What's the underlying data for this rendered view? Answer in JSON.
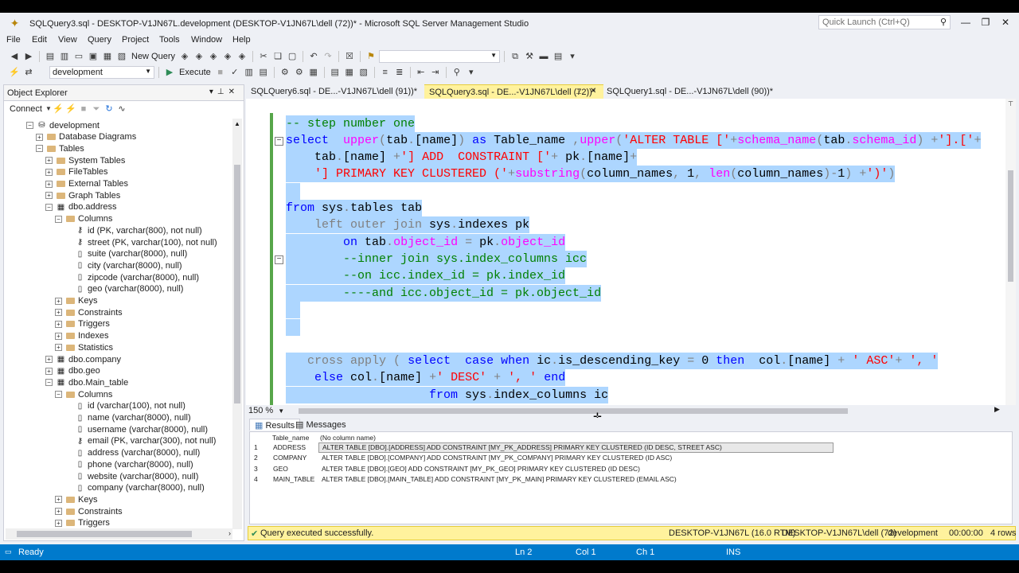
{
  "window": {
    "title": "SQLQuery3.sql - DESKTOP-V1JN67L.development (DESKTOP-V1JN67L\\dell (72))* - Microsoft SQL Server Management Studio",
    "quick_launch_placeholder": "Quick Launch (Ctrl+Q)"
  },
  "menu": [
    "File",
    "Edit",
    "View",
    "Query",
    "Project",
    "Tools",
    "Window",
    "Help"
  ],
  "toolbar": {
    "new_query": "New Query",
    "database": "development",
    "execute": "Execute"
  },
  "object_explorer": {
    "title": "Object Explorer",
    "connect": "Connect",
    "tree": [
      {
        "label": "development",
        "level": 0,
        "exp": "-",
        "icon": "database"
      },
      {
        "label": "Database Diagrams",
        "level": 1,
        "exp": "+",
        "icon": "folder"
      },
      {
        "label": "Tables",
        "level": 1,
        "exp": "-",
        "icon": "folder"
      },
      {
        "label": "System Tables",
        "level": 2,
        "exp": "+",
        "icon": "folder"
      },
      {
        "label": "FileTables",
        "level": 2,
        "exp": "+",
        "icon": "folder"
      },
      {
        "label": "External Tables",
        "level": 2,
        "exp": "+",
        "icon": "folder"
      },
      {
        "label": "Graph Tables",
        "level": 2,
        "exp": "+",
        "icon": "folder"
      },
      {
        "label": "dbo.address",
        "level": 2,
        "exp": "-",
        "icon": "table"
      },
      {
        "label": "Columns",
        "level": 3,
        "exp": "-",
        "icon": "folder"
      },
      {
        "label": "id (PK, varchar(800), not null)",
        "level": 4,
        "exp": "",
        "icon": "key"
      },
      {
        "label": "street (PK, varchar(100), not null)",
        "level": 4,
        "exp": "",
        "icon": "key"
      },
      {
        "label": "suite (varchar(8000), null)",
        "level": 4,
        "exp": "",
        "icon": "column"
      },
      {
        "label": "city (varchar(8000), null)",
        "level": 4,
        "exp": "",
        "icon": "column"
      },
      {
        "label": "zipcode (varchar(8000), null)",
        "level": 4,
        "exp": "",
        "icon": "column"
      },
      {
        "label": "geo (varchar(8000), null)",
        "level": 4,
        "exp": "",
        "icon": "column"
      },
      {
        "label": "Keys",
        "level": 3,
        "exp": "+",
        "icon": "folder"
      },
      {
        "label": "Constraints",
        "level": 3,
        "exp": "+",
        "icon": "folder"
      },
      {
        "label": "Triggers",
        "level": 3,
        "exp": "+",
        "icon": "folder"
      },
      {
        "label": "Indexes",
        "level": 3,
        "exp": "+",
        "icon": "folder"
      },
      {
        "label": "Statistics",
        "level": 3,
        "exp": "+",
        "icon": "folder"
      },
      {
        "label": "dbo.company",
        "level": 2,
        "exp": "+",
        "icon": "table"
      },
      {
        "label": "dbo.geo",
        "level": 2,
        "exp": "+",
        "icon": "table"
      },
      {
        "label": "dbo.Main_table",
        "level": 2,
        "exp": "-",
        "icon": "table"
      },
      {
        "label": "Columns",
        "level": 3,
        "exp": "-",
        "icon": "folder"
      },
      {
        "label": "id (varchar(100), not null)",
        "level": 4,
        "exp": "",
        "icon": "column"
      },
      {
        "label": "name (varchar(8000), null)",
        "level": 4,
        "exp": "",
        "icon": "column"
      },
      {
        "label": "username (varchar(8000), null)",
        "level": 4,
        "exp": "",
        "icon": "column"
      },
      {
        "label": "email (PK, varchar(300), not null)",
        "level": 4,
        "exp": "",
        "icon": "key"
      },
      {
        "label": "address (varchar(8000), null)",
        "level": 4,
        "exp": "",
        "icon": "column"
      },
      {
        "label": "phone (varchar(8000), null)",
        "level": 4,
        "exp": "",
        "icon": "column"
      },
      {
        "label": "website (varchar(8000), null)",
        "level": 4,
        "exp": "",
        "icon": "column"
      },
      {
        "label": "company (varchar(8000), null)",
        "level": 4,
        "exp": "",
        "icon": "column"
      },
      {
        "label": "Keys",
        "level": 3,
        "exp": "+",
        "icon": "folder"
      },
      {
        "label": "Constraints",
        "level": 3,
        "exp": "+",
        "icon": "folder"
      },
      {
        "label": "Triggers",
        "level": 3,
        "exp": "+",
        "icon": "folder"
      }
    ]
  },
  "tabs": [
    {
      "label": "SQLQuery6.sql - DE...-V1JN67L\\dell (91))*",
      "active": false
    },
    {
      "label": "SQLQuery3.sql - DE...-V1JN67L\\dell (72))*",
      "active": true
    },
    {
      "label": "SQLQuery1.sql - DE...-V1JN67L\\dell (90))*",
      "active": false
    }
  ],
  "editor": {
    "zoom": "150 %",
    "lines": [
      [
        [
          "c",
          "-- step number one"
        ]
      ],
      [
        [
          "k",
          "select"
        ],
        [
          "t",
          "  "
        ],
        [
          "f",
          "upper"
        ],
        [
          "g",
          "("
        ],
        [
          "t",
          "tab"
        ],
        [
          "g",
          "."
        ],
        [
          "t",
          "[name]"
        ],
        [
          "g",
          ")"
        ],
        [
          "t",
          " "
        ],
        [
          "k",
          "as"
        ],
        [
          "t",
          " Table_name "
        ],
        [
          "g",
          ","
        ],
        [
          "f",
          "upper"
        ],
        [
          "g",
          "("
        ],
        [
          "s",
          "'ALTER TABLE ['"
        ],
        [
          "g",
          "+"
        ],
        [
          "f",
          "schema_name"
        ],
        [
          "g",
          "("
        ],
        [
          "t",
          "tab"
        ],
        [
          "g",
          "."
        ],
        [
          "f",
          "schema_id"
        ],
        [
          "g",
          ")"
        ],
        [
          "t",
          " "
        ],
        [
          "g",
          "+"
        ],
        [
          "s",
          "'].['"
        ],
        [
          "g",
          "+"
        ]
      ],
      [
        [
          "t",
          "    tab"
        ],
        [
          "g",
          "."
        ],
        [
          "t",
          "[name] "
        ],
        [
          "g",
          "+"
        ],
        [
          "s",
          "'] ADD  CONSTRAINT ['"
        ],
        [
          "g",
          "+"
        ],
        [
          "t",
          " pk"
        ],
        [
          "g",
          "."
        ],
        [
          "t",
          "[name]"
        ],
        [
          "g",
          "+"
        ]
      ],
      [
        [
          "s",
          "    '] PRIMARY KEY CLUSTERED ('"
        ],
        [
          "g",
          "+"
        ],
        [
          "f",
          "substring"
        ],
        [
          "g",
          "("
        ],
        [
          "t",
          "column_names"
        ],
        [
          "g",
          ","
        ],
        [
          "t",
          " 1"
        ],
        [
          "g",
          ","
        ],
        [
          "t",
          " "
        ],
        [
          "f",
          "len"
        ],
        [
          "g",
          "("
        ],
        [
          "t",
          "column_names"
        ],
        [
          "g",
          ")-"
        ],
        [
          "t",
          "1"
        ],
        [
          "g",
          ")"
        ],
        [
          "t",
          " "
        ],
        [
          "g",
          "+"
        ],
        [
          "s",
          "')'"
        ],
        [
          "g",
          ")"
        ]
      ],
      [
        [
          "t",
          "  "
        ]
      ],
      [
        [
          "k",
          "from"
        ],
        [
          "t",
          " "
        ],
        [
          "t",
          "sys"
        ],
        [
          "g",
          "."
        ],
        [
          "t",
          "tables tab"
        ]
      ],
      [
        [
          "t",
          "    "
        ],
        [
          "g",
          "left outer join"
        ],
        [
          "t",
          " sys"
        ],
        [
          "g",
          "."
        ],
        [
          "t",
          "indexes pk"
        ]
      ],
      [
        [
          "t",
          "        "
        ],
        [
          "k",
          "on"
        ],
        [
          "t",
          " tab"
        ],
        [
          "g",
          "."
        ],
        [
          "f",
          "object_id"
        ],
        [
          "t",
          " "
        ],
        [
          "g",
          "="
        ],
        [
          "t",
          " pk"
        ],
        [
          "g",
          "."
        ],
        [
          "f",
          "object_id"
        ]
      ],
      [
        [
          "c",
          "        --inner join sys.index_columns icc"
        ]
      ],
      [
        [
          "c",
          "        --on icc.index_id = pk.index_id"
        ]
      ],
      [
        [
          "c",
          "        ----and icc.object_id = pk.object_id"
        ]
      ],
      [
        [
          "t",
          "  "
        ]
      ],
      [
        [
          "t",
          "  "
        ]
      ],
      [
        [
          "t",
          "   "
        ],
        [
          "g",
          "cross apply ("
        ],
        [
          "t",
          " "
        ],
        [
          "k",
          "select"
        ],
        [
          "t",
          "  "
        ],
        [
          "k",
          "case"
        ],
        [
          "t",
          " "
        ],
        [
          "k",
          "when"
        ],
        [
          "t",
          " ic"
        ],
        [
          "g",
          "."
        ],
        [
          "t",
          "is_descending_key "
        ],
        [
          "g",
          "="
        ],
        [
          "t",
          " 0 "
        ],
        [
          "k",
          "then"
        ],
        [
          "t",
          "  col"
        ],
        [
          "g",
          "."
        ],
        [
          "t",
          "[name] "
        ],
        [
          "g",
          "+"
        ],
        [
          "t",
          " "
        ],
        [
          "s",
          "' ASC'"
        ],
        [
          "g",
          "+"
        ],
        [
          "t",
          " "
        ],
        [
          "s",
          "', '"
        ]
      ],
      [
        [
          "t",
          "    "
        ],
        [
          "k",
          "else"
        ],
        [
          "t",
          " col"
        ],
        [
          "g",
          "."
        ],
        [
          "t",
          "[name] "
        ],
        [
          "g",
          "+"
        ],
        [
          "s",
          "' DESC'"
        ],
        [
          "t",
          " "
        ],
        [
          "g",
          "+"
        ],
        [
          "t",
          " "
        ],
        [
          "s",
          "', '"
        ],
        [
          "t",
          " "
        ],
        [
          "k",
          "end"
        ]
      ],
      [
        [
          "t",
          "                    "
        ],
        [
          "k",
          "from"
        ],
        [
          "t",
          " sys"
        ],
        [
          "g",
          "."
        ],
        [
          "t",
          "index_columns ic"
        ]
      ]
    ]
  },
  "results": {
    "tab_results": "Results",
    "tab_messages": "Messages",
    "columns": [
      "Table_name",
      "(No column name)"
    ],
    "rows": [
      [
        "1",
        "ADDRESS",
        "ALTER TABLE [DBO].[ADDRESS] ADD  CONSTRAINT [MY_PK_ADDRESS] PRIMARY KEY CLUSTERED (ID DESC, STREET ASC)"
      ],
      [
        "2",
        "COMPANY",
        "ALTER TABLE [DBO].[COMPANY] ADD  CONSTRAINT [MY_PK_COMPANY] PRIMARY KEY CLUSTERED (ID ASC)"
      ],
      [
        "3",
        "GEO",
        "ALTER TABLE [DBO].[GEO] ADD  CONSTRAINT [MY_PK_GEO] PRIMARY KEY CLUSTERED (ID DESC)"
      ],
      [
        "4",
        "MAIN_TABLE",
        "ALTER TABLE [DBO].[MAIN_TABLE] ADD  CONSTRAINT [MY_PK_MAIN] PRIMARY KEY CLUSTERED (EMAIL ASC)"
      ]
    ]
  },
  "query_status": {
    "message": "Query executed successfully.",
    "server": "DESKTOP-V1JN67L (16.0 RTM)",
    "user": "DESKTOP-V1JN67L\\dell (72)",
    "database": "development",
    "time": "00:00:00",
    "rows": "4 rows"
  },
  "status_bar": {
    "ready": "Ready",
    "ln": "Ln 2",
    "col": "Col 1",
    "ch": "Ch 1",
    "ins": "INS"
  },
  "colors": {
    "status_blue": "#007acc",
    "selection": "#add6ff",
    "active_tab": "#fff29d",
    "keyword": "#0000ff",
    "function": "#ff00ff",
    "string": "#ff0000",
    "comment": "#008000"
  }
}
